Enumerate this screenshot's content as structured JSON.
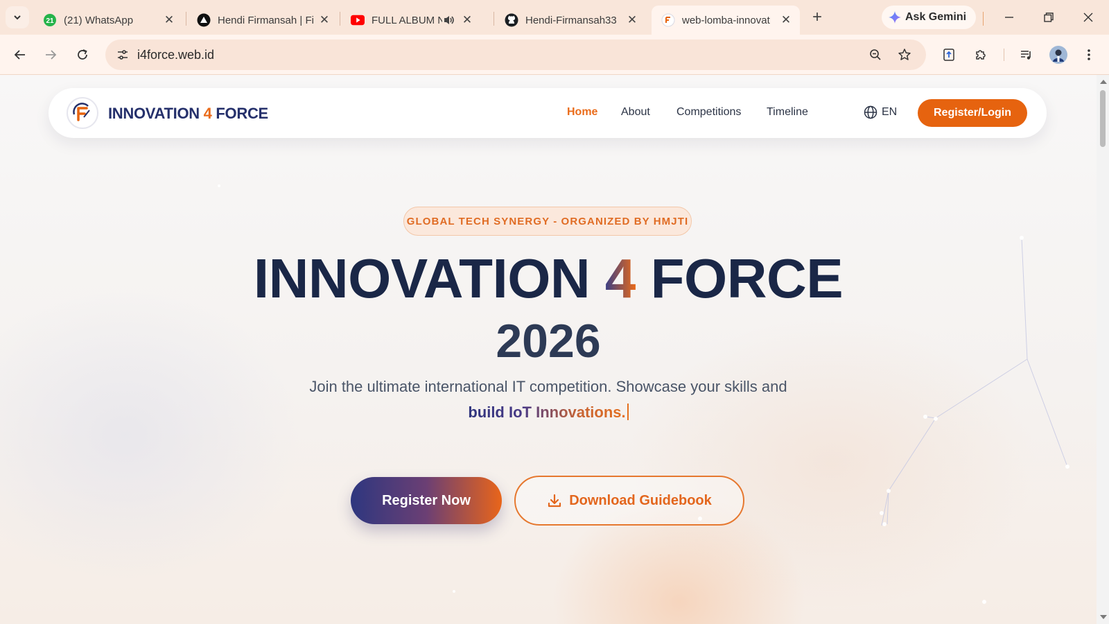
{
  "browser": {
    "tabs": [
      {
        "title": "(21) WhatsApp",
        "badge": "21",
        "icon": "whatsapp-icon"
      },
      {
        "title": "Hendi Firmansah | Fi",
        "icon": "vercel-icon"
      },
      {
        "title": "FULL ALBUM NE",
        "icon": "youtube-icon",
        "audio": true
      },
      {
        "title": "Hendi-Firmansah33",
        "icon": "github-icon"
      },
      {
        "title": "web-lomba-innovat",
        "icon": "site-logo-icon",
        "active": true
      }
    ],
    "gemini_label": "Ask Gemini",
    "url": "i4force.web.id"
  },
  "site": {
    "brand": {
      "part1": "INNOVATION ",
      "part2": "4",
      "part3": " FORCE"
    },
    "nav": {
      "home": "Home",
      "about": "About",
      "competitions": "Competitions",
      "timeline": "Timeline"
    },
    "language": "EN",
    "login_label": "Register/Login"
  },
  "hero": {
    "badge": "GLOBAL TECH SYNERGY - ORGANIZED BY HMJTI",
    "title_part1": "INNOVATION ",
    "title_part2": "4",
    "title_part3": " FORCE",
    "year": "2026",
    "subtitle": "Join the ultimate international IT competition. Showcase your skills and",
    "typed_text": "build IoT Innovations.",
    "primary_cta": "Register Now",
    "secondary_cta": "Download Guidebook"
  },
  "colors": {
    "accent": "#e6630f",
    "navy": "#1a2747",
    "brand_blue": "#25306b"
  }
}
